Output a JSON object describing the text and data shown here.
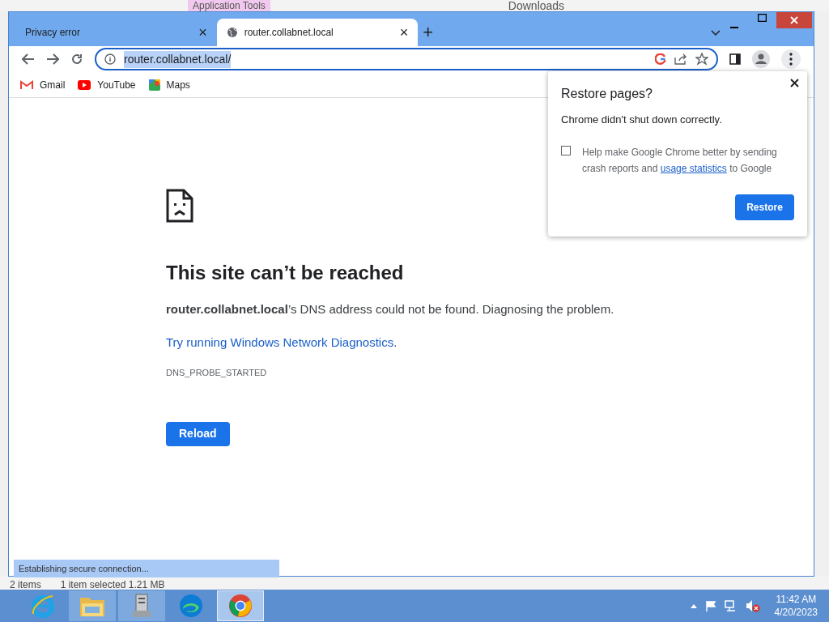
{
  "background_window": {
    "ribbon_tab": "Application Tools",
    "title": "Downloads",
    "status_items": "2 items",
    "status_selected": "1 item selected  1.21 MB"
  },
  "browser": {
    "tabs": [
      {
        "title": "Privacy error",
        "selected": false,
        "close": "×"
      },
      {
        "title": "router.collabnet.local",
        "selected": true,
        "close": "×"
      }
    ],
    "new_tab": "+",
    "address": "router.collabnet.local/",
    "bookmarks": [
      {
        "label": "Gmail",
        "kind": "gmail"
      },
      {
        "label": "YouTube",
        "kind": "youtube"
      },
      {
        "label": "Maps",
        "kind": "maps"
      }
    ],
    "error": {
      "title": "This site can’t be reached",
      "message": "**router.collabnet.local**’s DNS address could not be found. Diagnosing the problem.",
      "link": "Try running Windows Network Diagnostics",
      "link_after": ".",
      "code": "DNS_PROBE_STARTED",
      "button": "Reload"
    },
    "popup": {
      "title": "Restore pages?",
      "message": "Chrome didn't shut down correctly.",
      "checkbox_text": "Help make Google Chrome better by sending crash reports and",
      "checkbox_link": "usage statistics",
      "checkbox_after": "to Google",
      "checked": false,
      "button": "Restore"
    },
    "status_bubble": "Establishing secure connection..."
  },
  "taskbar": {
    "apps": [
      {
        "kind": "ie",
        "selected": false
      },
      {
        "kind": "explorer",
        "selected": false
      },
      {
        "kind": "server",
        "selected": false
      },
      {
        "kind": "edge",
        "selected": false
      },
      {
        "kind": "chrome",
        "selected": true
      }
    ],
    "time": "11:42 AM",
    "date": "4/20/2023"
  }
}
